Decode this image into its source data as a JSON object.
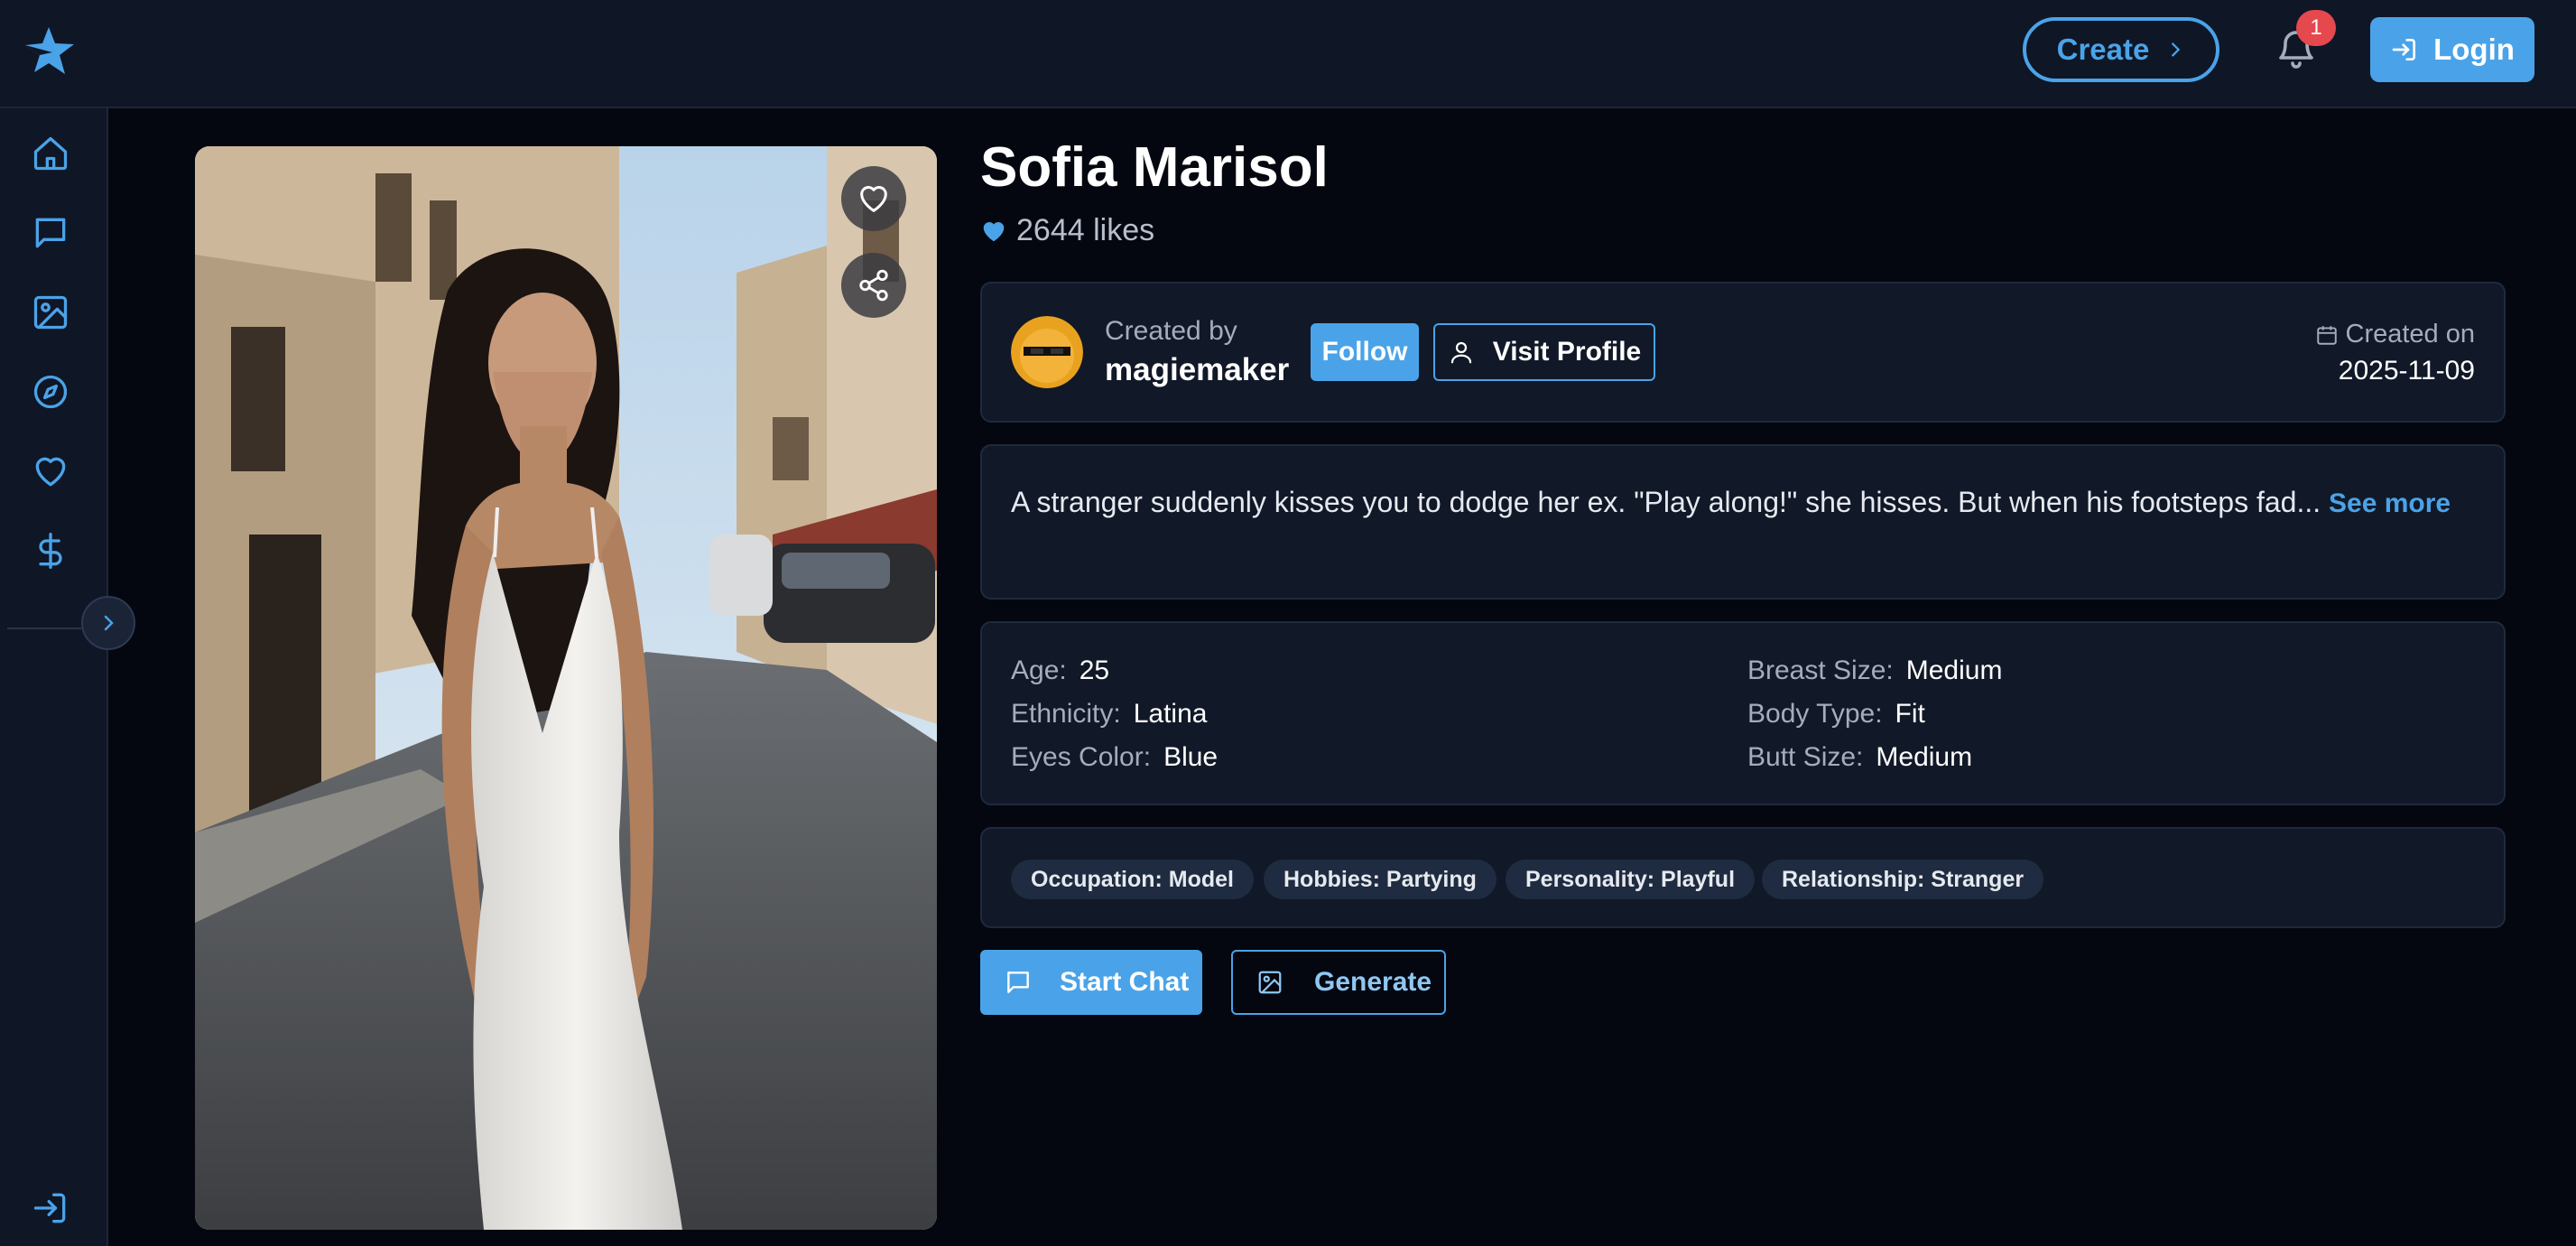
{
  "header": {
    "create_label": "Create",
    "notification_count": "1",
    "login_label": "Login",
    "icons": [
      "star-logo-icon",
      "chevron-right-icon",
      "bell-icon",
      "login-icon"
    ]
  },
  "sidebar": {
    "items": [
      {
        "icon": "home-icon"
      },
      {
        "icon": "chat-icon"
      },
      {
        "icon": "image-icon"
      },
      {
        "icon": "compass-icon"
      },
      {
        "icon": "heart-icon"
      },
      {
        "icon": "dollar-icon"
      }
    ],
    "collapse_icon": "chevron-right-icon",
    "bottom_icon": "login-icon"
  },
  "character": {
    "name": "Sofia Marisol",
    "likes": "2644 likes",
    "created_by_label": "Created by",
    "creator": "magiemaker",
    "follow_label": "Follow",
    "visit_profile_label": "Visit Profile",
    "created_on_label": "Created on",
    "created_on": "2025-11-09",
    "description": "A stranger suddenly kisses you to dodge her ex. \"Play along!\" she hisses. But when his footsteps fad...",
    "see_more_label": "See more",
    "attributes": {
      "age": {
        "label": "Age:",
        "value": "25"
      },
      "ethnicity": {
        "label": "Ethnicity:",
        "value": "Latina"
      },
      "eyes_color": {
        "label": "Eyes Color:",
        "value": "Blue"
      },
      "breast_size": {
        "label": "Breast Size:",
        "value": "Medium"
      },
      "body_type": {
        "label": "Body Type:",
        "value": "Fit"
      },
      "butt_size": {
        "label": "Butt Size:",
        "value": "Medium"
      }
    },
    "tags": [
      "Occupation: Model",
      "Hobbies: Partying",
      "Personality: Playful",
      "Relationship: Stranger"
    ]
  },
  "actions": {
    "start_chat_label": "Start Chat",
    "generate_label": "Generate"
  },
  "colors": {
    "accent": "#4aa3e8",
    "background": "#04070f",
    "panel": "#111827",
    "badge": "#e5484d"
  }
}
